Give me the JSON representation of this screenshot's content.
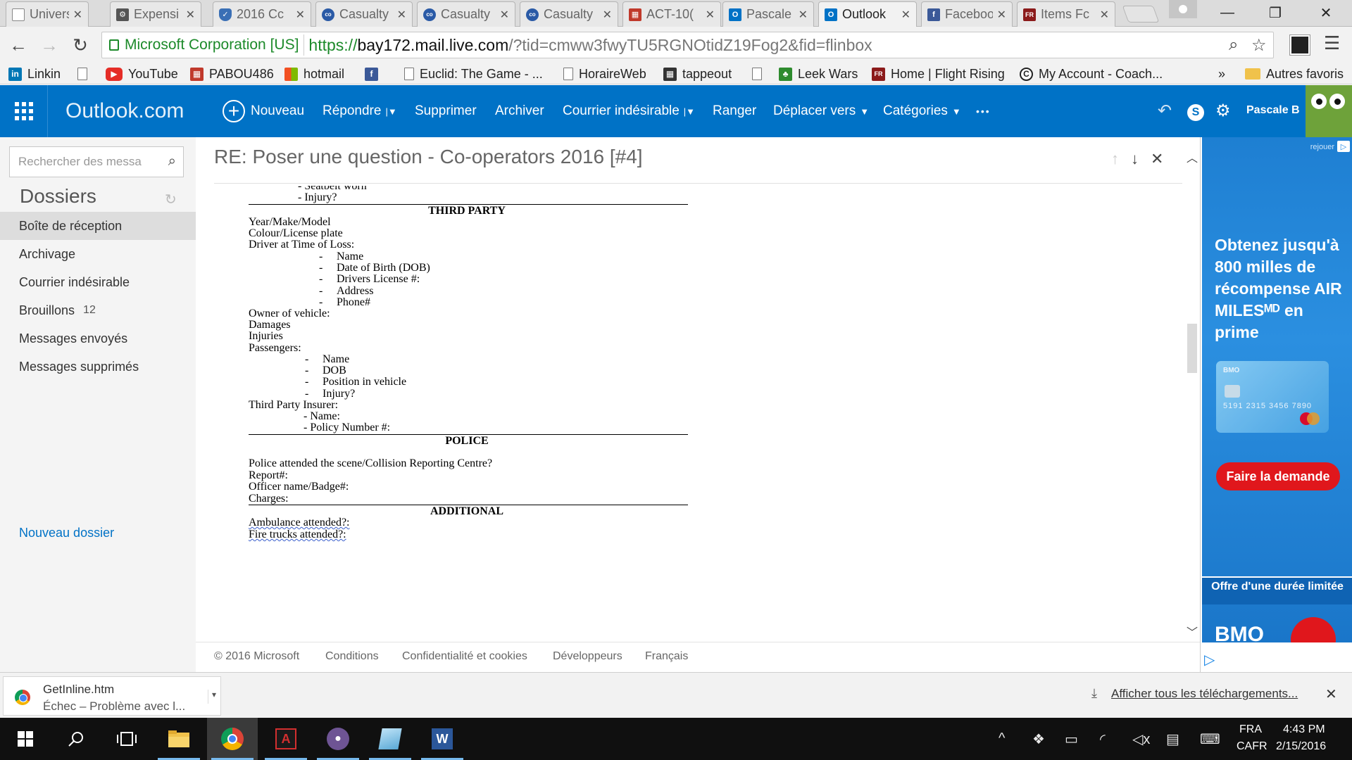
{
  "browser": {
    "tabs": [
      {
        "label": "Universi",
        "icon": "page-icon",
        "color": "#ffffff",
        "active": false
      },
      {
        "label": "Expensi",
        "icon": "expensify-icon",
        "color": "#555555",
        "active": false
      },
      {
        "label": "2016 Cc",
        "icon": "shield-icon",
        "color": "#3a6fb5",
        "active": false
      },
      {
        "label": "Casualty",
        "icon": "co-operators-icon",
        "color": "#2a5aa6",
        "active": false
      },
      {
        "label": "Casualty",
        "icon": "co-operators-icon",
        "color": "#2a5aa6",
        "active": false
      },
      {
        "label": "Casualty",
        "icon": "co-operators-icon",
        "color": "#2a5aa6",
        "active": false
      },
      {
        "label": "ACT-10(",
        "icon": "grid-icon",
        "color": "#c0392b",
        "active": false
      },
      {
        "label": "Pascale",
        "icon": "outlook-icon",
        "color": "#0072c6",
        "active": false
      },
      {
        "label": "Outlook",
        "icon": "outlook-icon",
        "color": "#0072c6",
        "active": true
      },
      {
        "label": "Faceboo",
        "icon": "facebook-icon",
        "color": "#3b5998",
        "active": false
      },
      {
        "label": "Items Fc",
        "icon": "flight-rising-icon",
        "color": "#8b1a1a",
        "active": false
      }
    ],
    "window_controls": {
      "minimize": "—",
      "restore": "❐",
      "close": "✕"
    },
    "address": {
      "ev_label": "Microsoft Corporation [US]",
      "scheme": "https://",
      "host": "bay172.mail.live.com",
      "rest": "/?tid=cmww3fwyTU5RGNOtidZ19Fog2&fid=flinbox"
    },
    "bookmarks": [
      {
        "label": "Linkin",
        "icon": "linkedin-icon",
        "color": "#0077b5",
        "glyph": "in"
      },
      {
        "label": "YouTube",
        "icon": "youtube-icon",
        "color": "#e52d27",
        "glyph": "▶"
      },
      {
        "label": "PABOU486",
        "icon": "grid-icon",
        "color": "#c0392b",
        "glyph": "▦"
      },
      {
        "label": "hotmail",
        "icon": "windows-icon",
        "color": "#f25022",
        "glyph": "▦"
      },
      {
        "label": "",
        "icon": "facebook-icon",
        "color": "#3b5998",
        "glyph": "f"
      },
      {
        "label": "Euclid: The Game - ...",
        "icon": "page-icon",
        "color": "#ffffff",
        "glyph": ""
      },
      {
        "label": "HoraireWeb",
        "icon": "page-icon",
        "color": "#ffffff",
        "glyph": ""
      },
      {
        "label": "tappeout",
        "icon": "tappedout-icon",
        "color": "#333333",
        "glyph": "▦"
      },
      {
        "label": "",
        "icon": "page-icon",
        "color": "#ffffff",
        "glyph": ""
      },
      {
        "label": "Leek Wars",
        "icon": "leek-icon",
        "color": "#2e8b2e",
        "glyph": "♣"
      },
      {
        "label": "Home | Flight Rising",
        "icon": "flight-rising-icon",
        "color": "#8b1a1a",
        "glyph": "FR"
      },
      {
        "label": "My Account - Coach...",
        "icon": "coach-icon",
        "color": "#ffffff",
        "glyph": "C"
      }
    ],
    "bookmarks_overflow": "»",
    "other_bookmarks": "Autres favoris"
  },
  "outlook": {
    "brand": "Outlook.com",
    "commands": {
      "new": "Nouveau",
      "reply": "Répondre",
      "delete": "Supprimer",
      "archive": "Archiver",
      "junk": "Courrier indésirable",
      "sweep": "Ranger",
      "move": "Déplacer vers",
      "categories": "Catégories",
      "more": "•••"
    },
    "user_name": "Pascale B",
    "search_placeholder": "Rechercher des messa",
    "folders_title": "Dossiers",
    "folders": [
      {
        "label": "Boîte de réception",
        "count": "",
        "selected": true
      },
      {
        "label": "Archivage",
        "count": "",
        "selected": false
      },
      {
        "label": "Courrier indésirable",
        "count": "",
        "selected": false
      },
      {
        "label": "Brouillons",
        "count": "12",
        "selected": false
      },
      {
        "label": "Messages envoyés",
        "count": "",
        "selected": false
      },
      {
        "label": "Messages supprimés",
        "count": "",
        "selected": false
      }
    ],
    "new_folder": "Nouveau dossier",
    "message": {
      "subject": "RE: Poser une question - Co-operators 2016 [#4]",
      "body": {
        "top_lines": [
          "- Seatbelt worn",
          "- Injury?"
        ],
        "third_party_heading": "THIRD PARTY",
        "tp_lines": [
          "Year/Make/Model",
          "Colour/License plate",
          "Driver at Time of Loss:"
        ],
        "driver_items": [
          "Name",
          "Date of Birth (DOB)",
          "Drivers License #:",
          "Address",
          "Phone#"
        ],
        "owner_lines": [
          "Owner of vehicle:",
          "Damages",
          "Injuries",
          "Passengers:"
        ],
        "passenger_items": [
          "Name",
          "DOB",
          "Position in vehicle",
          "Injury?"
        ],
        "insurer_line": "Third Party Insurer:",
        "insurer_items": [
          "- Name:",
          "- Policy Number #:"
        ],
        "police_heading": "POLICE",
        "police_lines": [
          "Police attended the scene/Collision Reporting Centre?",
          "Report#:",
          "Officer name/Badge#:",
          "Charges:"
        ],
        "additional_heading": "ADDITIONAL",
        "additional_lines": [
          "Ambulance attended?:",
          "Fire trucks attended?:"
        ]
      }
    },
    "footer": [
      "© 2016 Microsoft",
      "Conditions",
      "Confidentialité et cookies",
      "Développeurs",
      "Français"
    ]
  },
  "ad": {
    "replay": "rejouer",
    "headline": "Obtenez jusqu'à 800 milles de récompense AIR MILESᴹᴰ en prime",
    "card_number": "5191 2315 3456 7890",
    "card_brand": "BMO",
    "cta": "Faire la demande",
    "offer": "Offre d'une durée limitée",
    "bank": "BMO"
  },
  "downloads": {
    "file_name": "GetInline.htm",
    "status": "Échec – Problème avec l...",
    "show_all": "Afficher tous les téléchargements..."
  },
  "taskbar": {
    "apps": [
      "start",
      "search",
      "task-view",
      "file-explorer",
      "chrome",
      "acrobat",
      "github",
      "notepad",
      "word"
    ],
    "lang_line1": "FRA",
    "lang_line2": "CAFR",
    "time": "4:43 PM",
    "date": "2/15/2016"
  },
  "colors": {
    "outlook_blue": "#0072c6",
    "ev_green": "#1c8a2a",
    "ad_blue": "#1e7fd2",
    "ad_red": "#e0171c"
  }
}
